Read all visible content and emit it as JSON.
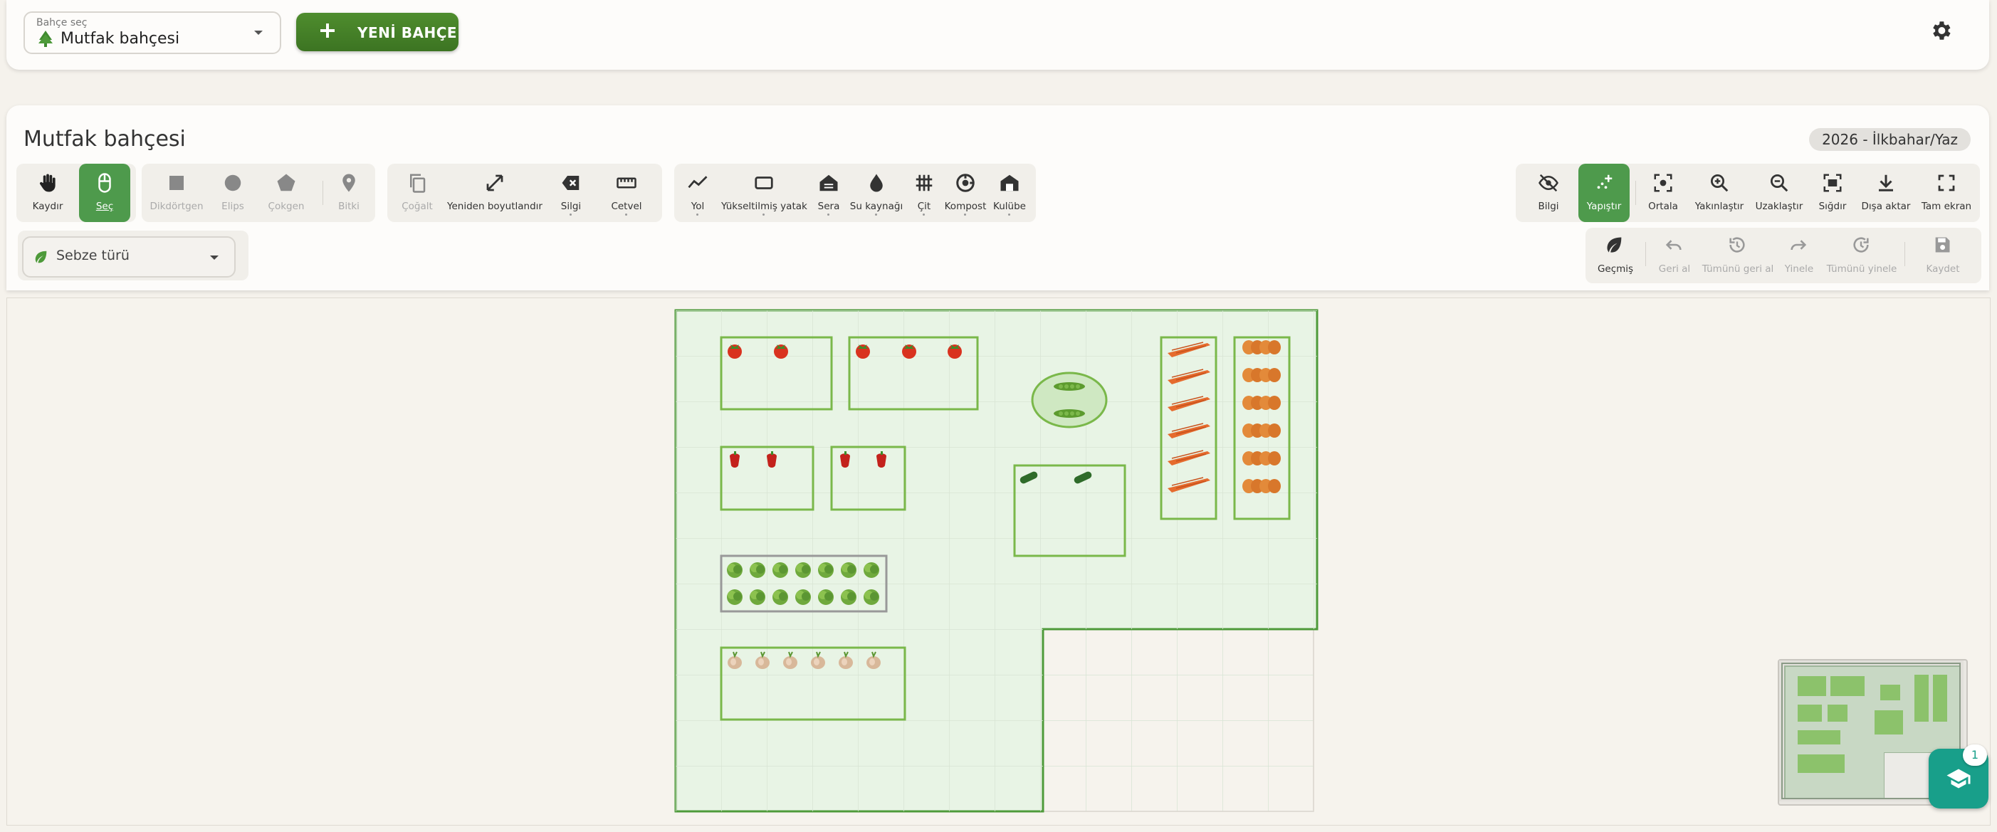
{
  "header": {
    "garden_select_label": "Bahçe seç",
    "garden_select_value": "Mutfak bahçesi",
    "new_garden_label": "YENİ BAHÇE"
  },
  "garden": {
    "title": "Mutfak bahçesi",
    "season": "2026 - İlkbahar/Yaz"
  },
  "toolbar": {
    "pan": "Kaydır",
    "select": "Seç",
    "rectangle": "Dikdörtgen",
    "ellipse": "Elips",
    "polygon": "Çokgen",
    "plant": "Bitki",
    "duplicate": "Çoğalt",
    "resize": "Yeniden boyutlandır",
    "eraser": "Silgi",
    "ruler": "Cetvel",
    "path": "Yol",
    "raised_bed": "Yükseltilmiş yatak",
    "greenhouse": "Sera",
    "water_source": "Su kaynağı",
    "fence": "Çit",
    "compost": "Kompost",
    "shed": "Kulübe",
    "info": "Bilgi",
    "snap": "Yapıştır",
    "center": "Ortala",
    "zoom_in": "Yakınlaştır",
    "zoom_out": "Uzaklaştır",
    "fit": "Sığdır",
    "export": "Dışa aktar",
    "fullscreen": "Tam ekran",
    "history": "Geçmiş",
    "undo": "Geri al",
    "undo_all": "Tümünü geri al",
    "redo": "Yinele",
    "redo_all": "Tümünü yinele",
    "save": "Kaydet"
  },
  "vegetable_type": {
    "placeholder": "Sebze türü"
  },
  "plants": [
    "tomato",
    "pepper",
    "cucumber",
    "lettuce",
    "onion",
    "green-bean",
    "carrot",
    "squash"
  ],
  "help_badge": "1",
  "colors": {
    "primary_green": "#4e9a4c",
    "garden_fill": "#e8f4e5",
    "bed_border": "#7ab84a",
    "teal": "#189f8a"
  }
}
